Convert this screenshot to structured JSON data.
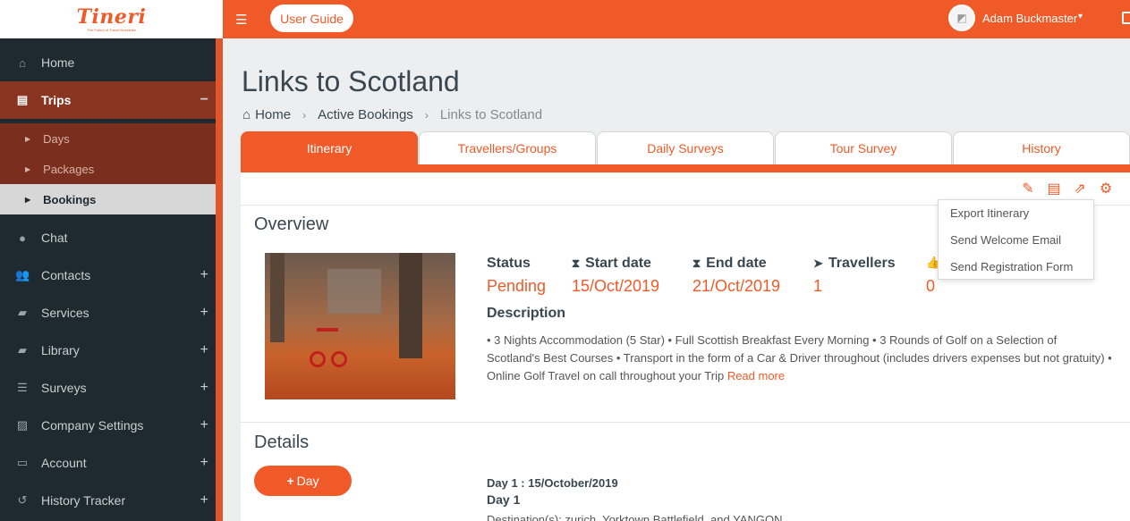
{
  "brand": {
    "logo": "Tineri",
    "tagline": "The Future of Travel Itineraries"
  },
  "sidebar": {
    "items": [
      {
        "label": "Home",
        "icon": "home-icon"
      },
      {
        "label": "Trips",
        "icon": "trips-icon",
        "toggle": "−"
      },
      {
        "label": "Chat",
        "icon": "chat-icon"
      },
      {
        "label": "Contacts",
        "icon": "contacts-icon",
        "toggle": "+"
      },
      {
        "label": "Services",
        "icon": "folder-icon",
        "toggle": "+"
      },
      {
        "label": "Library",
        "icon": "folder-icon",
        "toggle": "+"
      },
      {
        "label": "Surveys",
        "icon": "list-icon",
        "toggle": "+"
      },
      {
        "label": "Company Settings",
        "icon": "settings-icon",
        "toggle": "+"
      },
      {
        "label": "Account",
        "icon": "card-icon",
        "toggle": "+"
      },
      {
        "label": "History Tracker",
        "icon": "history-icon",
        "toggle": "+"
      }
    ],
    "trips_sub": [
      {
        "label": "Days"
      },
      {
        "label": "Packages"
      },
      {
        "label": "Bookings"
      }
    ]
  },
  "topbar": {
    "guide_label": "User Guide",
    "user_name": "Adam Buckmaster"
  },
  "page": {
    "title": "Links to Scotland",
    "breadcrumb": [
      "Home",
      "Active Bookings",
      "Links to Scotland"
    ]
  },
  "tabs": [
    "Itinerary",
    "Travellers/Groups",
    "Daily Surveys",
    "Tour Survey",
    "History"
  ],
  "overview": {
    "title": "Overview",
    "stats": [
      {
        "label": "Status",
        "value": "Pending",
        "icon": ""
      },
      {
        "label": "Start date",
        "value": "15/Oct/2019",
        "icon": "hourglass-icon"
      },
      {
        "label": "End date",
        "value": "21/Oct/2019",
        "icon": "hourglass-icon"
      },
      {
        "label": "Travellers",
        "value": "1",
        "icon": "paper-plane-icon"
      },
      {
        "label": "",
        "value": "0",
        "icon": "thumbs-up-icon"
      }
    ],
    "description_label": "Description",
    "description": "•  3 Nights Accommodation (5 Star) •  Full Scottish Breakfast Every Morning •  3 Rounds of Golf on a Selection of Scotland's Best Courses •  Transport in the form of a Car & Driver throughout (includes drivers expenses but not gratuity)  •  Online Golf Travel on call throughout your Trip ",
    "read_more": "Read more"
  },
  "dropdown": [
    "Export Itinerary",
    "Send Welcome Email",
    "Send Registration Form"
  ],
  "details": {
    "title": "Details",
    "add_day": "Day",
    "day_heading": "Day 1 : 15/October/2019",
    "day_sub": "Day 1",
    "destinations": "Destination(s): zurich, Yorktown Battlefield, and YANGON"
  },
  "colors": {
    "accent": "#f05a28",
    "sidebar": "#1e2930",
    "trips_active": "#8a3522"
  }
}
